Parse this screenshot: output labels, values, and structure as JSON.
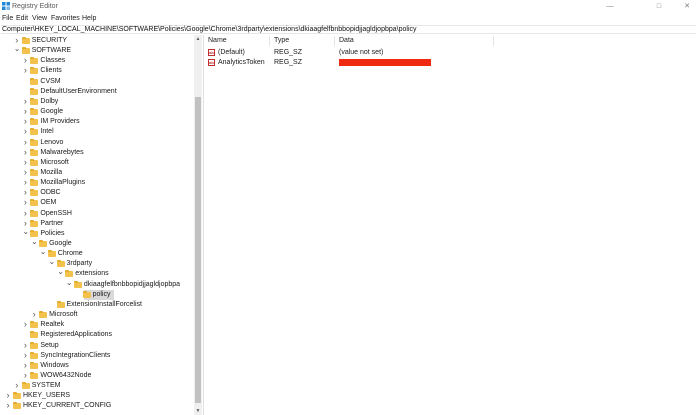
{
  "window": {
    "title": "Registry Editor",
    "minimize_glyph": "—",
    "maximize_glyph": "□",
    "close_glyph": "✕"
  },
  "menu": {
    "items": [
      "File",
      "Edit",
      "View",
      "Favorites",
      "Help"
    ]
  },
  "address": {
    "path": "Computer\\HKEY_LOCAL_MACHINE\\SOFTWARE\\Policies\\Google\\Chrome\\3rdparty\\extensions\\dkiaagfelfbnbbopidjjagldjopbpa\\policy"
  },
  "tree": {
    "items": [
      {
        "label": "SECURITY",
        "level": 1,
        "expander": "right"
      },
      {
        "label": "SOFTWARE",
        "level": 1,
        "expander": "down"
      },
      {
        "label": "Classes",
        "level": 2,
        "expander": "right"
      },
      {
        "label": "Clients",
        "level": 2,
        "expander": "right"
      },
      {
        "label": "CVSM",
        "level": 2,
        "expander": "none"
      },
      {
        "label": "DefaultUserEnvironment",
        "level": 2,
        "expander": "none"
      },
      {
        "label": "Dolby",
        "level": 2,
        "expander": "right"
      },
      {
        "label": "Google",
        "level": 2,
        "expander": "right"
      },
      {
        "label": "IM Providers",
        "level": 2,
        "expander": "right"
      },
      {
        "label": "Intel",
        "level": 2,
        "expander": "right"
      },
      {
        "label": "Lenovo",
        "level": 2,
        "expander": "right"
      },
      {
        "label": "Malwarebytes",
        "level": 2,
        "expander": "right"
      },
      {
        "label": "Microsoft",
        "level": 2,
        "expander": "right"
      },
      {
        "label": "Mozilla",
        "level": 2,
        "expander": "right"
      },
      {
        "label": "MozillaPlugins",
        "level": 2,
        "expander": "right"
      },
      {
        "label": "ODBC",
        "level": 2,
        "expander": "right"
      },
      {
        "label": "OEM",
        "level": 2,
        "expander": "right"
      },
      {
        "label": "OpenSSH",
        "level": 2,
        "expander": "right"
      },
      {
        "label": "Partner",
        "level": 2,
        "expander": "right"
      },
      {
        "label": "Policies",
        "level": 2,
        "expander": "down"
      },
      {
        "label": "Google",
        "level": 3,
        "expander": "down"
      },
      {
        "label": "Chrome",
        "level": 4,
        "expander": "down"
      },
      {
        "label": "3rdparty",
        "level": 5,
        "expander": "down"
      },
      {
        "label": "extensions",
        "level": 6,
        "expander": "down"
      },
      {
        "label": "dkiaagfelfbnbbopidjjagldjopbpa",
        "level": 7,
        "expander": "down"
      },
      {
        "label": "policy",
        "level": 8,
        "expander": "none",
        "selected": true
      },
      {
        "label": "ExtensionInstallForcelist",
        "level": 5,
        "expander": "none"
      },
      {
        "label": "Microsoft",
        "level": 3,
        "expander": "right"
      },
      {
        "label": "Realtek",
        "level": 2,
        "expander": "right"
      },
      {
        "label": "RegisteredApplications",
        "level": 2,
        "expander": "none"
      },
      {
        "label": "Setup",
        "level": 2,
        "expander": "right"
      },
      {
        "label": "SyncIntegrationClients",
        "level": 2,
        "expander": "right"
      },
      {
        "label": "Windows",
        "level": 2,
        "expander": "right"
      },
      {
        "label": "WOW6432Node",
        "level": 2,
        "expander": "right"
      },
      {
        "label": "SYSTEM",
        "level": 1,
        "expander": "right"
      },
      {
        "label": "HKEY_USERS",
        "level": 0,
        "expander": "right"
      },
      {
        "label": "HKEY_CURRENT_CONFIG",
        "level": 0,
        "expander": "right"
      }
    ]
  },
  "list": {
    "columns": {
      "name": "Name",
      "type": "Type",
      "data": "Data"
    },
    "rows": [
      {
        "icon_text": "ab",
        "name": "(Default)",
        "type": "REG_SZ",
        "data": "(value not set)",
        "redacted": false
      },
      {
        "icon_text": "ab",
        "name": "AnalyticsToken",
        "type": "REG_SZ",
        "data": "",
        "redacted": true
      }
    ]
  },
  "colors": {
    "folder": "#f3c24d",
    "selection": "#d9d9d9",
    "redaction": "#f02a10",
    "app_icon": "#1e88d6"
  }
}
